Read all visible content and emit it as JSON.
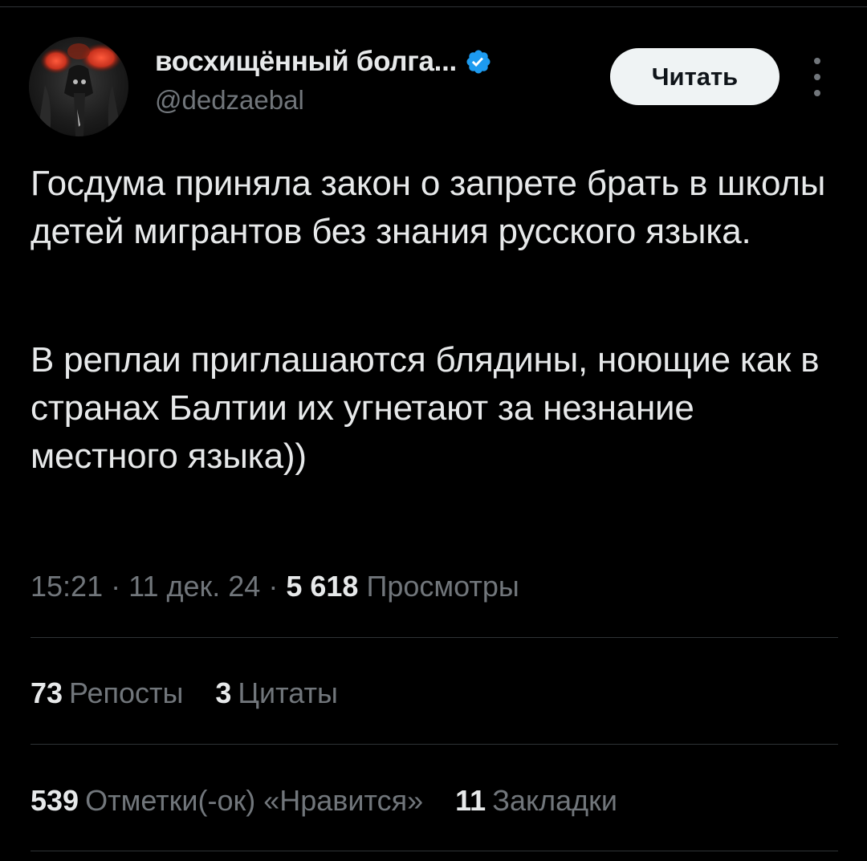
{
  "author": {
    "display_name": "восхищённый болга...",
    "handle": "@dedzaebal",
    "verified_icon": "verified-badge-icon",
    "avatar_icon": "avatar-image"
  },
  "follow_button": {
    "label": "Читать"
  },
  "more_menu": {
    "icon": "more-vertical-icon"
  },
  "tweet": {
    "paragraph_1": "Госдума приняла закон о запрете брать в школы детей мигрантов без знания русского языка.",
    "paragraph_2": "В реплаи приглашаются блядины, ноющие как в странах Балтии их угнетают за незнание местного языка))"
  },
  "meta": {
    "time": "15:21",
    "separator": "·",
    "date": "11 дек. 24",
    "views_count": "5 618",
    "views_label": "Просмотры"
  },
  "stats": {
    "reposts_count": "73",
    "reposts_label": "Репосты",
    "quotes_count": "3",
    "quotes_label": "Цитаты",
    "likes_count": "539",
    "likes_label": "Отметки(-ок) «Нравится»",
    "bookmarks_count": "11",
    "bookmarks_label": "Закладки"
  },
  "colors": {
    "background": "#000000",
    "primary_text": "#e7e9ea",
    "secondary_text": "#71767b",
    "divider": "#2f3336",
    "verified_blue": "#1d9bf0",
    "button_bg": "#eff3f4"
  }
}
